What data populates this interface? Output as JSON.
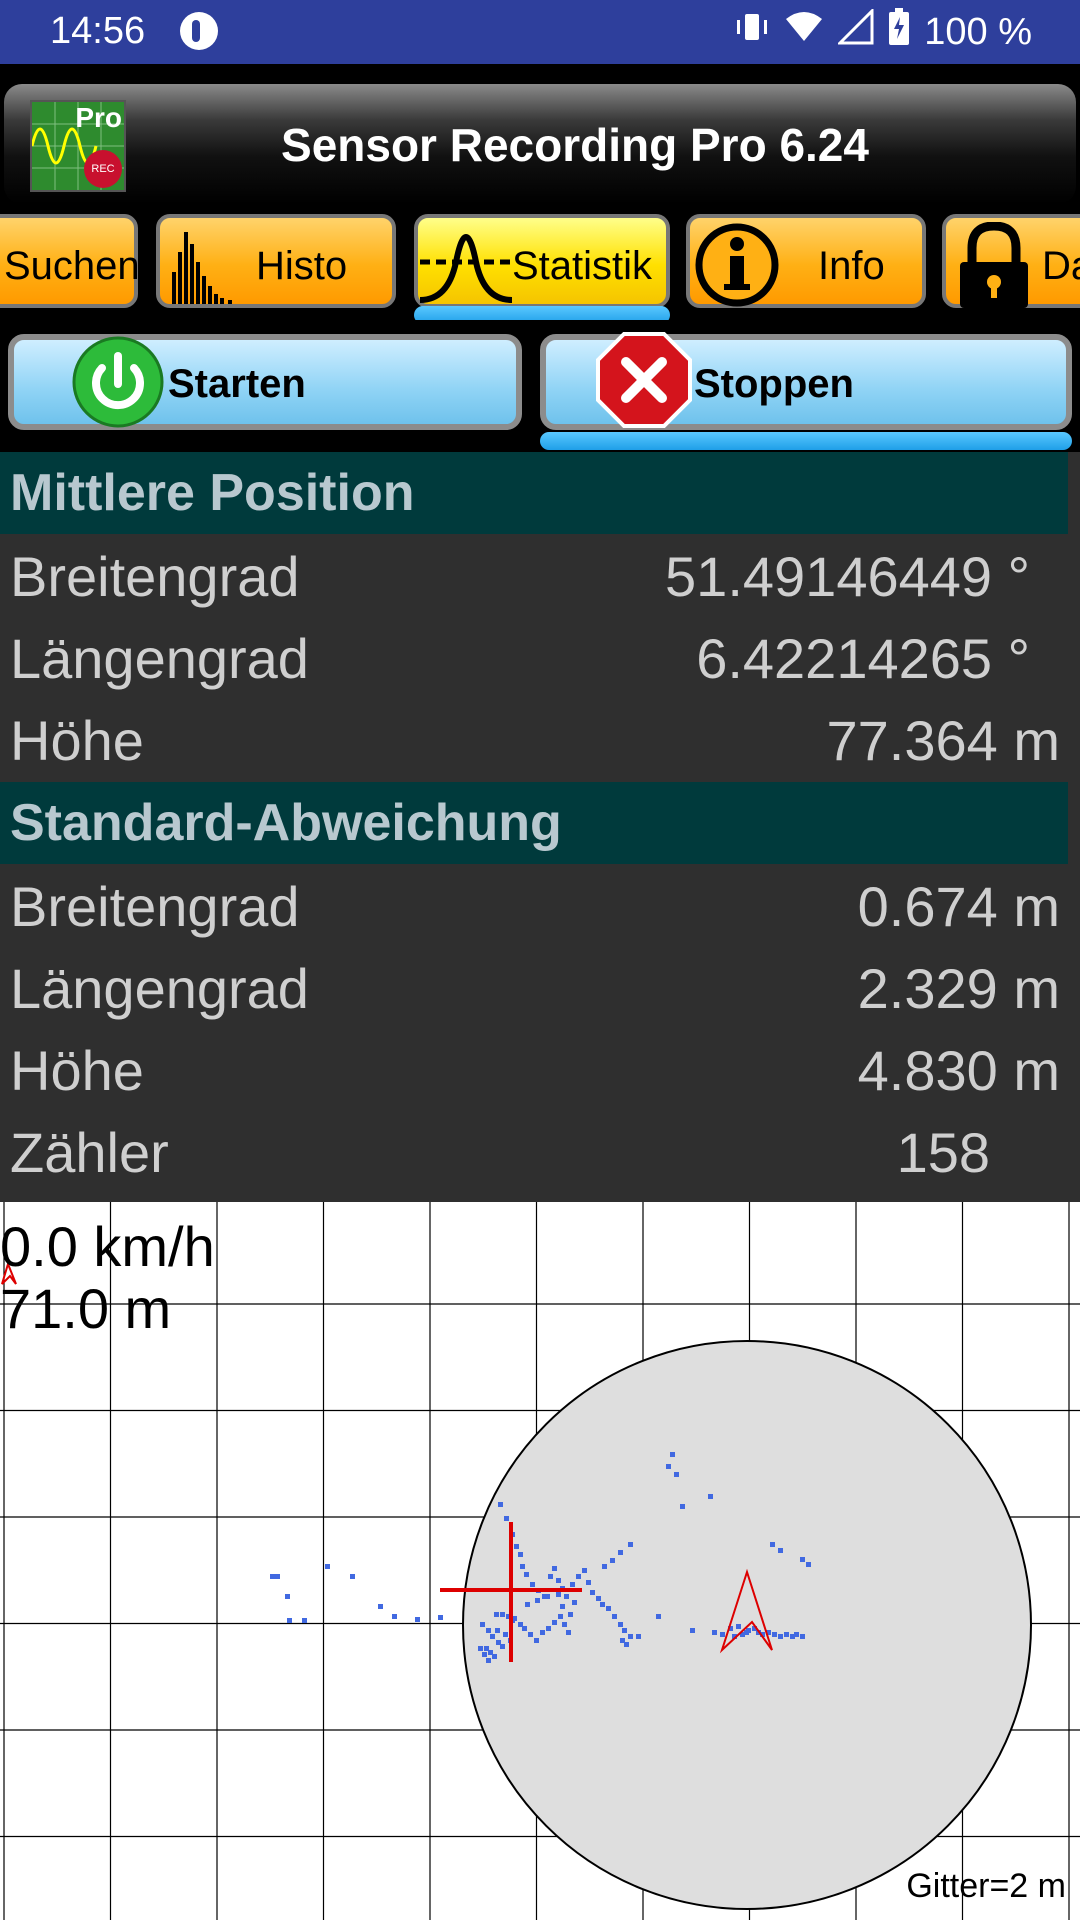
{
  "status_bar": {
    "time": "14:56",
    "battery": "100 %",
    "icons": [
      "vibrate-icon",
      "wifi-icon",
      "signal-icon",
      "battery-charging-icon"
    ]
  },
  "header": {
    "title": "Sensor Recording Pro 6.24",
    "logo_text": "Pro",
    "logo_badge": "REC"
  },
  "tabs": [
    {
      "label": "Suchen",
      "icon": "search-icon"
    },
    {
      "label": "Histo",
      "icon": "histogram-icon"
    },
    {
      "label": "Statistik",
      "icon": "bell-curve-icon",
      "active": true
    },
    {
      "label": "Info",
      "icon": "info-icon"
    },
    {
      "label": "Da",
      "icon": "lock-icon"
    }
  ],
  "controls": {
    "start_label": "Starten",
    "stop_label": "Stoppen",
    "start_icon": "power-icon",
    "stop_icon": "stop-icon"
  },
  "mean_position": {
    "header": "Mittlere Position",
    "rows": [
      {
        "label": "Breitengrad",
        "value": "51.49146449 °"
      },
      {
        "label": "Längengrad",
        "value": "6.42214265 °"
      },
      {
        "label": "Höhe",
        "value": "77.364 m"
      }
    ]
  },
  "std_deviation": {
    "header": "Standard-Abweichung",
    "rows": [
      {
        "label": "Breitengrad",
        "value": "0.674 m"
      },
      {
        "label": "Längengrad",
        "value": "2.329 m"
      },
      {
        "label": "Höhe",
        "value": "4.830 m"
      }
    ]
  },
  "counter": {
    "label": "Zähler",
    "value": "158"
  },
  "map": {
    "speed": "0.0 km/h",
    "altitude": "71.0 m",
    "grid_label": "Gitter=2 m"
  },
  "colors": {
    "status_bar": "#2e3f9c",
    "section_header": "#003a3c",
    "panel": "#2f2f2f",
    "tab_orange": "#ffb014",
    "tab_active": "#ffe000",
    "button_blue": "#8fd3f5",
    "point_blue": "#4169e1",
    "crosshair_red": "#dd0000"
  }
}
